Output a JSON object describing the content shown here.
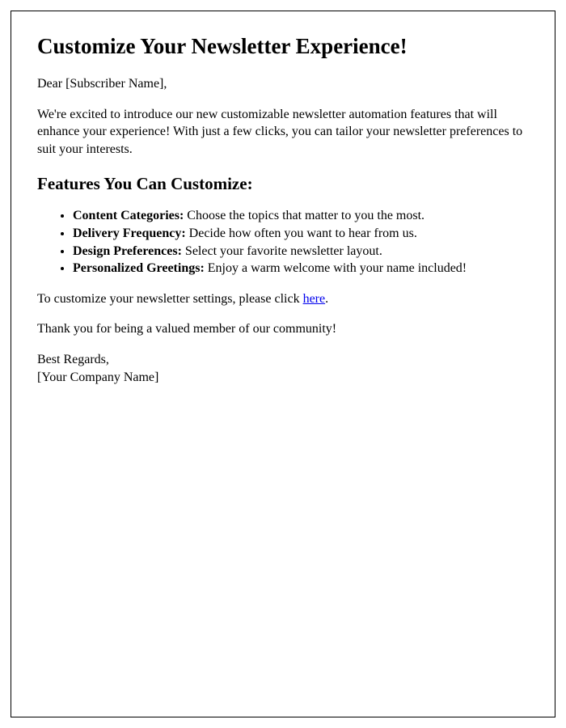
{
  "title": "Customize Your Newsletter Experience!",
  "greeting": "Dear [Subscriber Name],",
  "intro": "We're excited to introduce our new customizable newsletter automation features that will enhance your experience! With just a few clicks, you can tailor your newsletter preferences to suit your interests.",
  "features_heading": "Features You Can Customize:",
  "features": [
    {
      "label": "Content Categories:",
      "desc": " Choose the topics that matter to you the most."
    },
    {
      "label": "Delivery Frequency:",
      "desc": " Decide how often you want to hear from us."
    },
    {
      "label": "Design Preferences:",
      "desc": " Select your favorite newsletter layout."
    },
    {
      "label": "Personalized Greetings:",
      "desc": " Enjoy a warm welcome with your name included!"
    }
  ],
  "cta_prefix": "To customize your newsletter settings, please click ",
  "cta_link_text": "here",
  "cta_suffix": ".",
  "thankyou": "Thank you for being a valued member of our community!",
  "signoff_line1": "Best Regards,",
  "signoff_line2": "[Your Company Name]"
}
